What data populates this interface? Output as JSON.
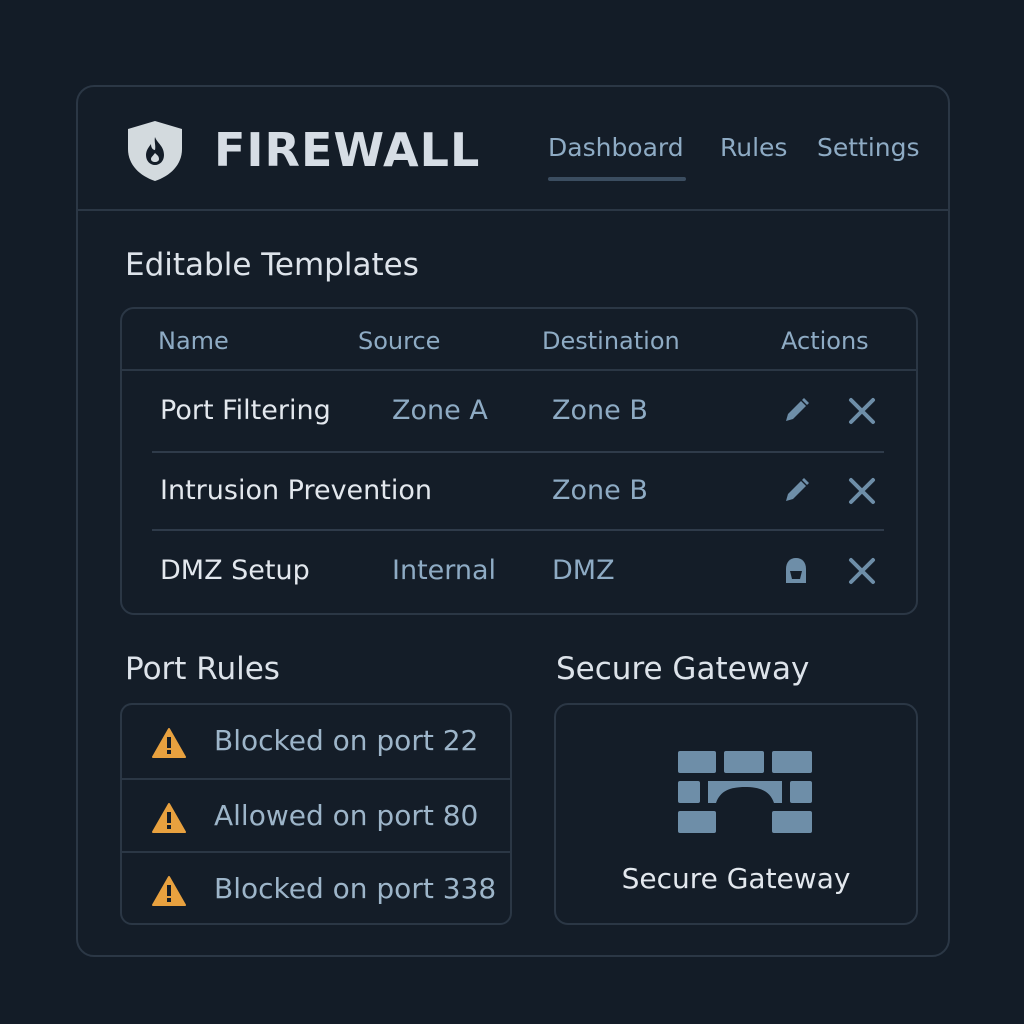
{
  "app": {
    "title": "FIREWALL"
  },
  "nav": {
    "tabs": [
      {
        "label": "Dashboard",
        "active": true
      },
      {
        "label": "Rules",
        "active": false
      },
      {
        "label": "Settings",
        "active": false
      }
    ]
  },
  "templates": {
    "title": "Editable Templates",
    "columns": [
      "Name",
      "Source",
      "Destination",
      "Actions"
    ],
    "rows": [
      {
        "name": "Port Filtering",
        "source": "Zone A",
        "destination": "Zone B",
        "actions": [
          "pencil-icon",
          "close-icon"
        ]
      },
      {
        "name": "Intrusion Prevention",
        "source": "",
        "destination": "Zone B",
        "actions": [
          "pencil-icon",
          "close-icon"
        ]
      },
      {
        "name": "DMZ Setup",
        "source": "Internal",
        "destination": "DMZ",
        "actions": [
          "bucket-icon",
          "close-icon"
        ]
      }
    ]
  },
  "port_rules": {
    "title": "Port Rules",
    "items": [
      {
        "text": "Blocked on port 22",
        "icon": "warning-icon"
      },
      {
        "text": "Allowed on port 80",
        "icon": "warning-icon"
      },
      {
        "text": "Blocked on port 338",
        "icon": "warning-icon"
      }
    ]
  },
  "gateway": {
    "title": "Secure Gateway",
    "label": "Secure Gateway",
    "icon": "brick-wall-icon"
  },
  "colors": {
    "background": "#131c27",
    "border": "#2b3745",
    "accent_text": "#8eabc4",
    "warning": "#e8a13f",
    "icon_fill": "#6e8ea8"
  }
}
